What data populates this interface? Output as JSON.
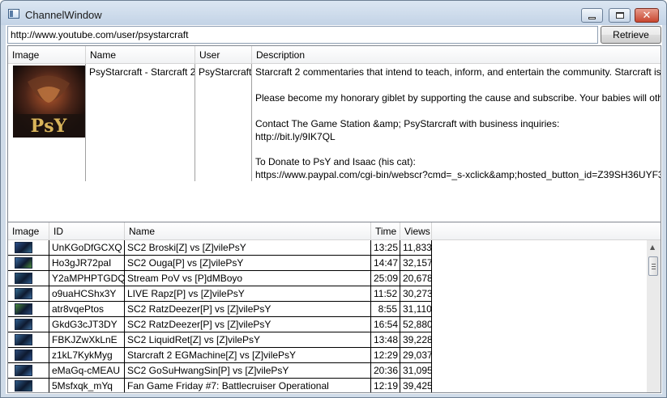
{
  "window": {
    "title": "ChannelWindow"
  },
  "toolbar": {
    "url_value": "http://www.youtube.com/user/psystarcraft",
    "retrieve_label": "Retrieve"
  },
  "channel_grid": {
    "columns": [
      "Image",
      "Name",
      "User",
      "Description"
    ],
    "row": {
      "name": "PsyStarcraft - Starcraft 2",
      "user": "PsyStarcraft",
      "description_lines": [
        "Starcraft 2 commentaries that intend to teach, inform, and entertain the community. Starcraft is",
        "Please become my honorary giblet by supporting the cause and subscribe. Your babies will oth",
        "Contact The Game Station &amp; PsyStarcraft with business inquiries:",
        "http://bit.ly/9IK7QL",
        "To Donate to PsY and Isaac (his cat):",
        "https://www.paypal.com/cgi-bin/webscr?cmd=_s-xclick&amp;hosted_button_id=Z39SH36UYF3"
      ],
      "thumbnail_text": "PsY"
    },
    "scroll_left_icon": "scroll-left-icon",
    "scroll_right_icon": "scroll-right-icon"
  },
  "video_grid": {
    "columns": [
      "Image",
      "ID",
      "Name",
      "Time",
      "Views"
    ],
    "rows": [
      {
        "id": "UnKGoDfGCXQ",
        "name": "SC2 Broski[Z] vs [Z]vilePsY",
        "time": "13:25",
        "views": "11,833"
      },
      {
        "id": "Ho3gJR72paI",
        "name": "SC2 Ouga[P] vs [Z]vilePsY",
        "time": "14:47",
        "views": "32,157"
      },
      {
        "id": "Y2aMPHPTGDQ",
        "name": "Stream PoV vs [P]dMBoyo",
        "time": "25:09",
        "views": "20,678"
      },
      {
        "id": "o9uaHCShx3Y",
        "name": "LIVE Rapz[P] vs [Z]vilePsY",
        "time": "11:52",
        "views": "30,273"
      },
      {
        "id": "atr8vqePtos",
        "name": "SC2 RatzDeezer[P] vs [Z]vilePsY",
        "time": "8:55",
        "views": "31,110"
      },
      {
        "id": "GkdG3cJT3DY",
        "name": "SC2 RatzDeezer[P] vs [Z]vilePsY",
        "time": "16:54",
        "views": "52,880"
      },
      {
        "id": "FBKJZwXkLnE",
        "name": "SC2 LiquidRet[Z] vs [Z]vilePsY",
        "time": "13:48",
        "views": "39,228"
      },
      {
        "id": "z1kL7KykMyg",
        "name": "Starcraft 2 EGMachine[Z] vs [Z]vilePsY",
        "time": "12:29",
        "views": "29,037"
      },
      {
        "id": "eMaGq-cMEAU",
        "name": "SC2 GoSuHwangSin[P] vs [Z]vilePsY",
        "time": "20:36",
        "views": "31,095"
      },
      {
        "id": "5Msfxqk_mYq",
        "name": "Fan Game Friday #7: Battlecruiser Operational",
        "time": "12:19",
        "views": "39,425"
      }
    ]
  },
  "colors": {
    "window_frame": "#cfdbe8",
    "close_button": "#c84630",
    "grid_border": "#828790"
  }
}
